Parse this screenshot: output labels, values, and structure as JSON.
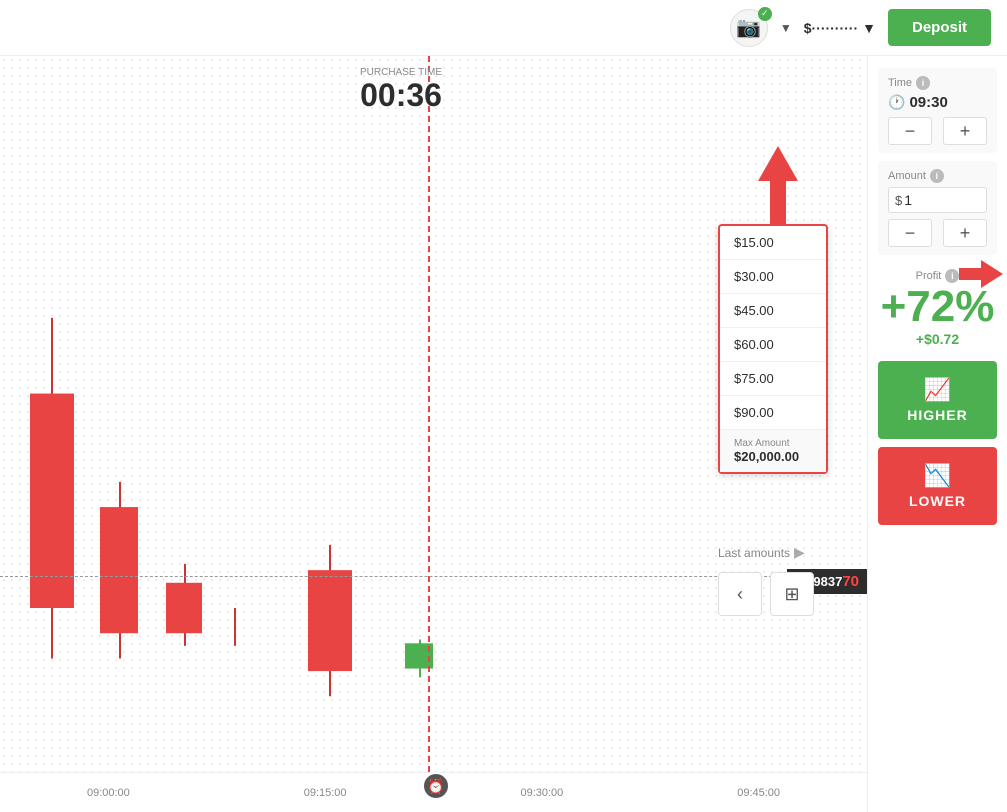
{
  "header": {
    "deposit_label": "Deposit",
    "balance_dots": "$··········",
    "balance_arrow": "▼",
    "camera_arrow": "▼"
  },
  "chart": {
    "purchase_time_text": "PURCHASE TIME",
    "purchase_time_value": "00:36",
    "price_value": "1.09837",
    "price_highlight": "70",
    "x_labels": [
      "09:00:00",
      "09:15:00",
      "09:30:00",
      "09:45:00"
    ]
  },
  "amount_dropdown": {
    "items": [
      "$15.00",
      "$30.00",
      "$45.00",
      "$60.00",
      "$75.00",
      "$90.00"
    ],
    "max_label": "Max Amount",
    "max_value": "$20,000.00",
    "last_amounts_label": "Last amounts"
  },
  "nav_buttons": {
    "back": "‹",
    "calc": "⊞"
  },
  "right_panel": {
    "time_label": "Time",
    "time_value": "09:30",
    "amount_label": "Amount",
    "amount_currency": "$",
    "amount_value": "1",
    "minus": "−",
    "plus": "+",
    "profit_label": "Profit",
    "profit_percent": "+72",
    "profit_symbol": "%",
    "profit_amount": "+$0.72",
    "higher_label": "HIGHER",
    "lower_label": "LOWER"
  }
}
